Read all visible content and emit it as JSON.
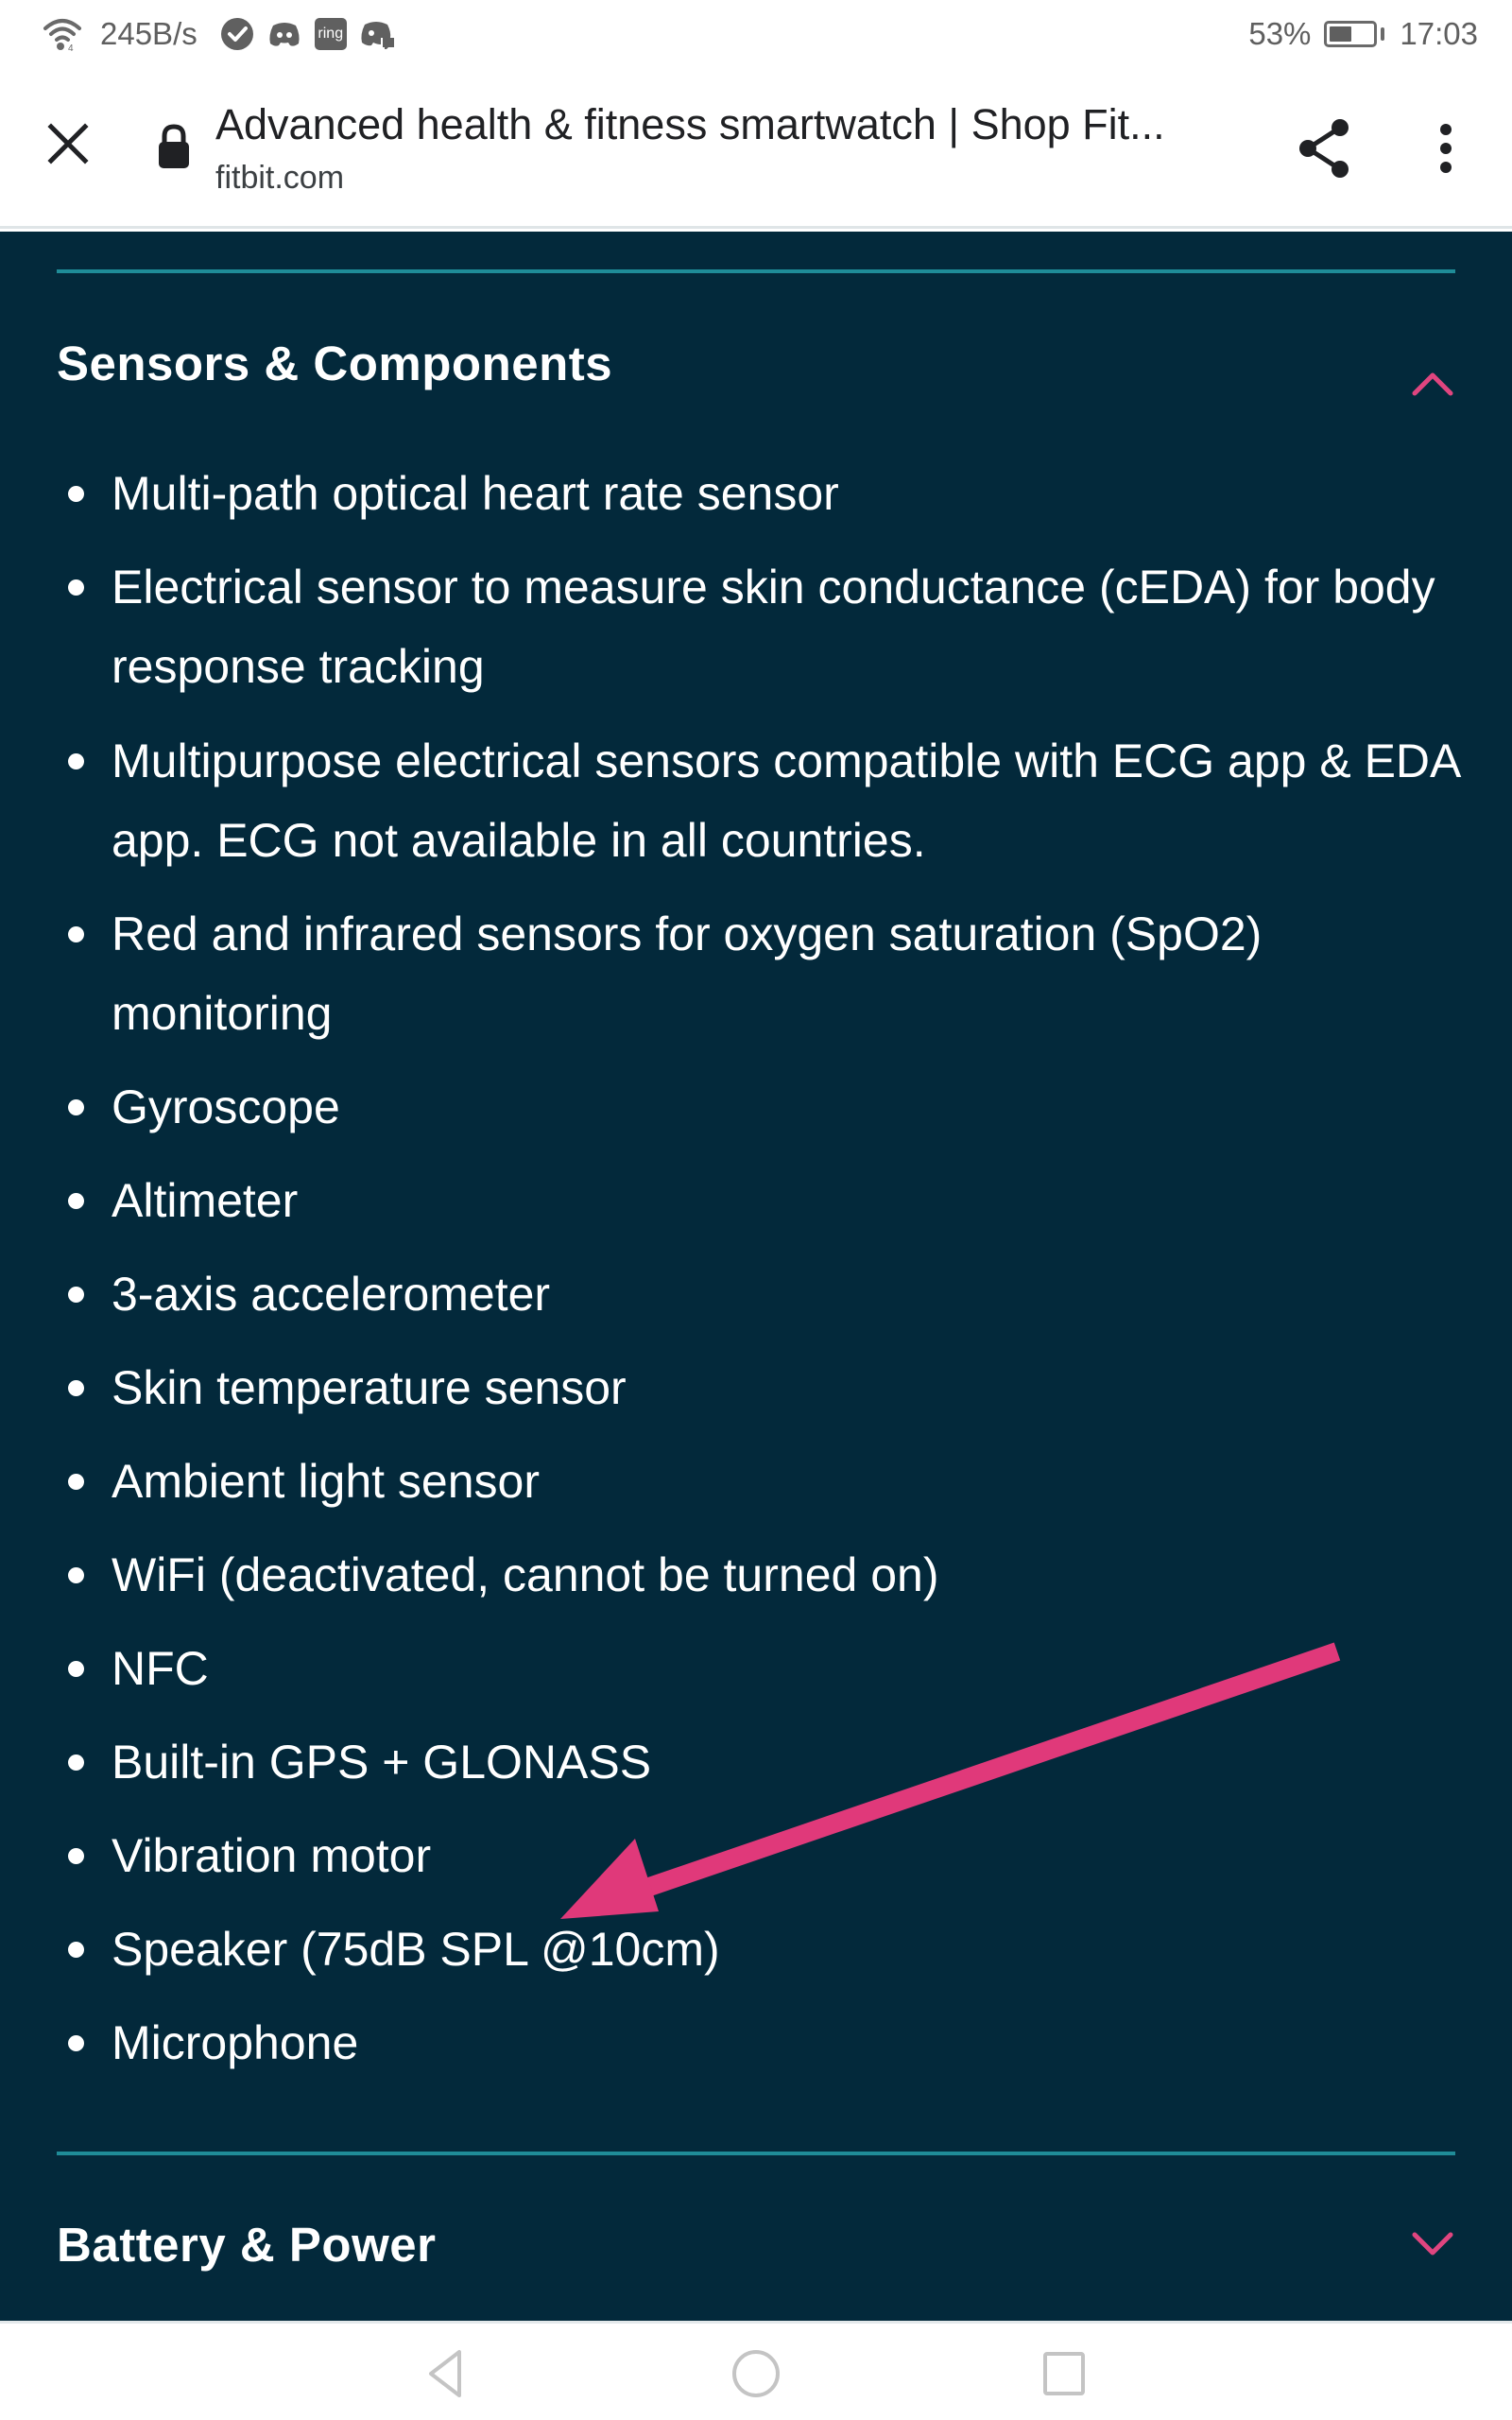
{
  "status_bar": {
    "network_speed": "245B/s",
    "notification_icons": [
      "wifi-icon",
      "check-circle-icon",
      "discord-icon",
      "ring-icon",
      "discord-notification-icon"
    ],
    "ring_label": "ring",
    "battery_percent": "53%",
    "battery_level": 0.53,
    "time": "17:03"
  },
  "browser": {
    "page_title": "Advanced health & fitness smartwatch | Shop Fit...",
    "url": "fitbit.com",
    "close_icon": "close-icon",
    "lock_icon": "lock-icon",
    "share_icon": "share-icon",
    "more_icon": "more-vert-icon"
  },
  "sections": [
    {
      "title": "Sensors & Components",
      "expanded": true,
      "chevron": "chevron-up-icon",
      "items": [
        "Multi-path optical heart rate sensor",
        "Electrical sensor to measure skin conductance (cEDA) for body response tracking",
        "Multipurpose electrical sensors compatible with ECG app & EDA app. ECG not available in all countries.",
        "Red and infrared sensors for oxygen saturation (SpO2) monitoring",
        "Gyroscope",
        "Altimeter",
        "3-axis accelerometer",
        "Skin temperature sensor",
        "Ambient light sensor",
        "WiFi (deactivated, cannot be turned on)",
        "NFC",
        "Built-in GPS + GLONASS",
        "Vibration motor",
        "Speaker (75dB SPL @10cm)",
        "Microphone"
      ]
    },
    {
      "title": "Battery & Power",
      "expanded": false,
      "chevron": "chevron-down-icon"
    }
  ],
  "annotation": {
    "type": "arrow",
    "points_to": "Speaker (75dB SPL @10cm)"
  },
  "colors": {
    "background": "#03293b",
    "divider": "#1f8c98",
    "accent": "#e0457f",
    "arrow": "#e0397a",
    "text": "#ffffff"
  },
  "nav_bar": {
    "back_icon": "back-icon",
    "home_icon": "home-icon",
    "recents_icon": "recents-icon"
  }
}
